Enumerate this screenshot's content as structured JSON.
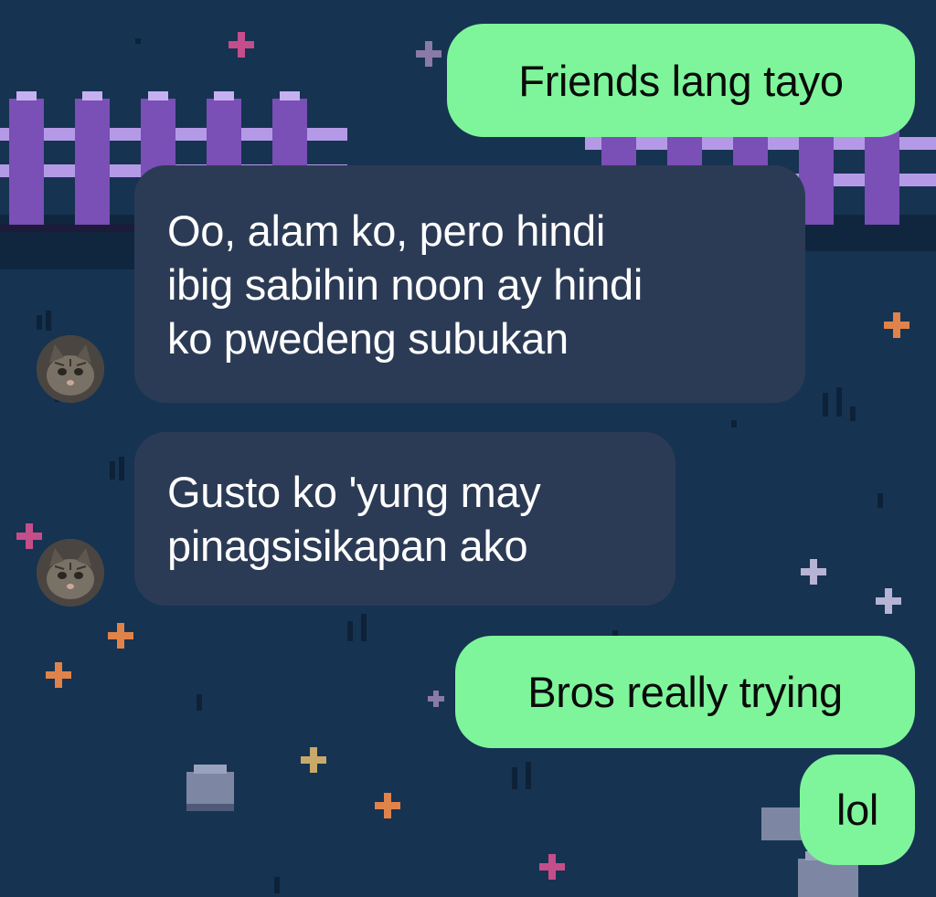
{
  "chat": {
    "messages": [
      {
        "direction": "outgoing",
        "lines": [
          "Friends lang tayo"
        ]
      },
      {
        "direction": "incoming",
        "lines": [
          "Oo, alam ko, pero hindi",
          "ibig sabihin noon ay hindi",
          "ko pwedeng subukan"
        ]
      },
      {
        "direction": "incoming",
        "lines": [
          "Gusto ko 'yung may",
          "pinagsisikapan ako"
        ]
      },
      {
        "direction": "outgoing",
        "lines": [
          "Bros really trying"
        ]
      },
      {
        "direction": "outgoing",
        "lines": [
          "lol"
        ]
      }
    ]
  },
  "colors": {
    "background": "#163352",
    "outgoing_bubble": "#7ef59a",
    "incoming_bubble": "#2c3b55",
    "fence": "#7a4fb6"
  },
  "icons": [
    "avatar-cat",
    "fence",
    "star",
    "rock"
  ]
}
